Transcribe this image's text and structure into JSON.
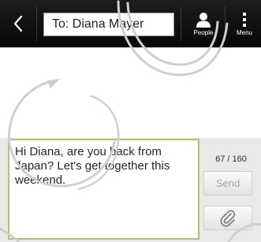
{
  "header": {
    "to_field": "To: Diana Mayer",
    "people_label": "People",
    "menu_label": "Menu",
    "icons": {
      "back": "back-chevron-icon",
      "people": "person-icon",
      "menu": "menu-dots-icon"
    }
  },
  "compose": {
    "message": "Hi Diana, are you back from Japan? Let's get together this weekend.",
    "char_count": "67 / 160",
    "send_label": "Send",
    "attach_icon": "paperclip-icon",
    "colors": {
      "accent_border": "#a7c86a",
      "panel_bg": "#e9e9e9",
      "send_disabled_text": "#a7a7a7"
    }
  },
  "colors": {
    "topbar": "#0b0b0b",
    "watermark": "#cfcfcf"
  }
}
